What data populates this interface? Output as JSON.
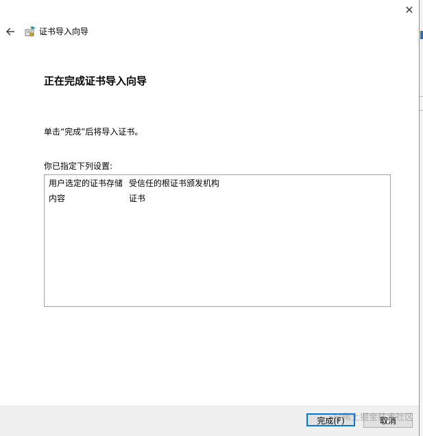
{
  "window": {
    "title": "证书导入向导",
    "close_glyph": "✕"
  },
  "main": {
    "heading": "正在完成证书导入向导",
    "instruction": "单击“完成”后将导入证书。",
    "settings_label": "你已指定下列设置:",
    "settings": [
      {
        "key": "用户选定的证书存储",
        "value": "受信任的根证书颁发机构"
      },
      {
        "key": "内容",
        "value": "证书"
      }
    ]
  },
  "footer": {
    "finish_label": "完成(F)",
    "cancel_label": "取消"
  },
  "watermark": "@稀土掘金技术社区",
  "colors": {
    "accent": "#0078d7",
    "footer_bg": "#f0f0f0",
    "button_bg": "#e1e1e1"
  },
  "icons": [
    "back-arrow-icon",
    "certificate-wizard-icon",
    "close-icon"
  ]
}
